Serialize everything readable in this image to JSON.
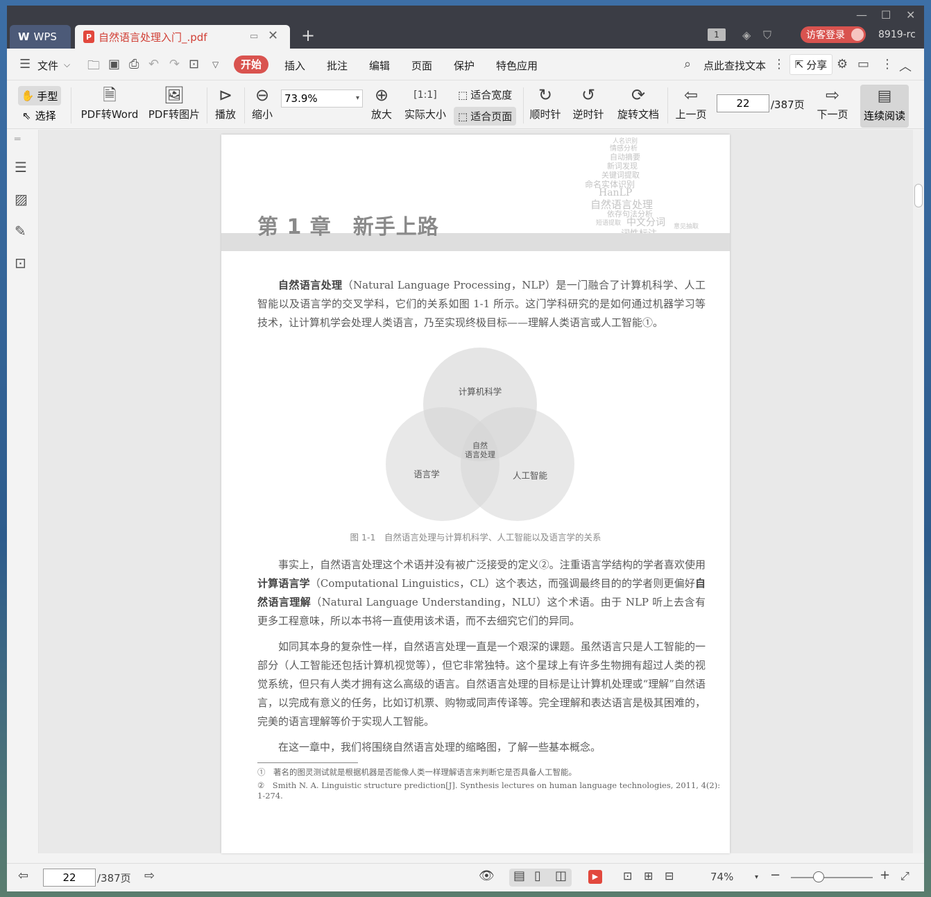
{
  "titlebar": {
    "app_tab": "WPS",
    "doc_tab": "自然语言处理入门_.pdf",
    "badge": "1",
    "login": "访客登录",
    "user_id": "8919-rc"
  },
  "menubar": {
    "file": "文件",
    "items": [
      "开始",
      "插入",
      "批注",
      "编辑",
      "页面",
      "保护",
      "特色应用"
    ],
    "search": "点此查找文本",
    "share": "分享"
  },
  "toolbar": {
    "hand": "手型",
    "select": "选择",
    "pdf_to_word": "PDF转Word",
    "pdf_to_image": "PDF转图片",
    "play": "播放",
    "zoom_out": "缩小",
    "zoom_value": "73.9%",
    "zoom_in": "放大",
    "actual_size": "实际大小",
    "fit_width": "适合宽度",
    "fit_page": "适合页面",
    "clockwise": "顺时针",
    "counter_clockwise": "逆时针",
    "rotate_doc": "旋转文档",
    "prev_page": "上一页",
    "current_page": "22",
    "total_pages": "/387页",
    "next_page": "下一页",
    "continuous": "连续阅读"
  },
  "page": {
    "chapter": "第 1 章　新手上路",
    "cloud_words": [
      "人名识别",
      "情感分析",
      "自动摘要",
      "新词发现",
      "关键词提取",
      "命名实体识别",
      "HanLP",
      "自然语言处理",
      "依存句法分析",
      "中文分词",
      "短语提取",
      "词性标注",
      "意见抽取"
    ],
    "para1_bold": "自然语言处理",
    "para1": "（Natural Language Processing，NLP）是一门融合了计算机科学、人工智能以及语言学的交叉学科，它们的关系如图 1-1 所示。这门学科研究的是如何通过机器学习等技术，让计算机学会处理人类语言，乃至实现终极目标——理解人类语言或人工智能①。",
    "venn": {
      "top": "计算机科学",
      "left": "语言学",
      "right": "人工智能",
      "center1": "自然",
      "center2": "语言处理"
    },
    "caption": "图 1-1　自然语言处理与计算机科学、人工智能以及语言学的关系",
    "para2a": "事实上，自然语言处理这个术语并没有被广泛接受的定义②。注重语言学结构的学者喜欢使用",
    "para2b": "计算语言学",
    "para2c": "（Computational Linguistics，CL）这个表达，而强调最终目的的学者则更偏好",
    "para2d": "自然语言理解",
    "para2e": "（Natural Language Understanding，NLU）这个术语。由于 NLP 听上去含有更多工程意味，所以本书将一直使用该术语，而不去细究它们的异同。",
    "para3": "如同其本身的复杂性一样，自然语言处理一直是一个艰深的课题。虽然语言只是人工智能的一部分（人工智能还包括计算机视觉等），但它非常独特。这个星球上有许多生物拥有超过人类的视觉系统，但只有人类才拥有这么高级的语言。自然语言处理的目标是让计算机处理或“理解”自然语言，以完成有意义的任务，比如订机票、购物或同声传译等。完全理解和表达语言是极其困难的，完美的语言理解等价于实现人工智能。",
    "para4": "在这一章中，我们将围绕自然语言处理的缩略图，了解一些基本概念。",
    "fn1": "①　著名的图灵测试就是根据机器是否能像人类一样理解语言来判断它是否具备人工智能。",
    "fn2": "②　Smith N. A. Linguistic structure prediction[J]. Synthesis lectures on human language technologies, 2011, 4(2): 1-274."
  },
  "statusbar": {
    "current_page": "22",
    "total_pages": "/387页",
    "zoom": "74%"
  }
}
